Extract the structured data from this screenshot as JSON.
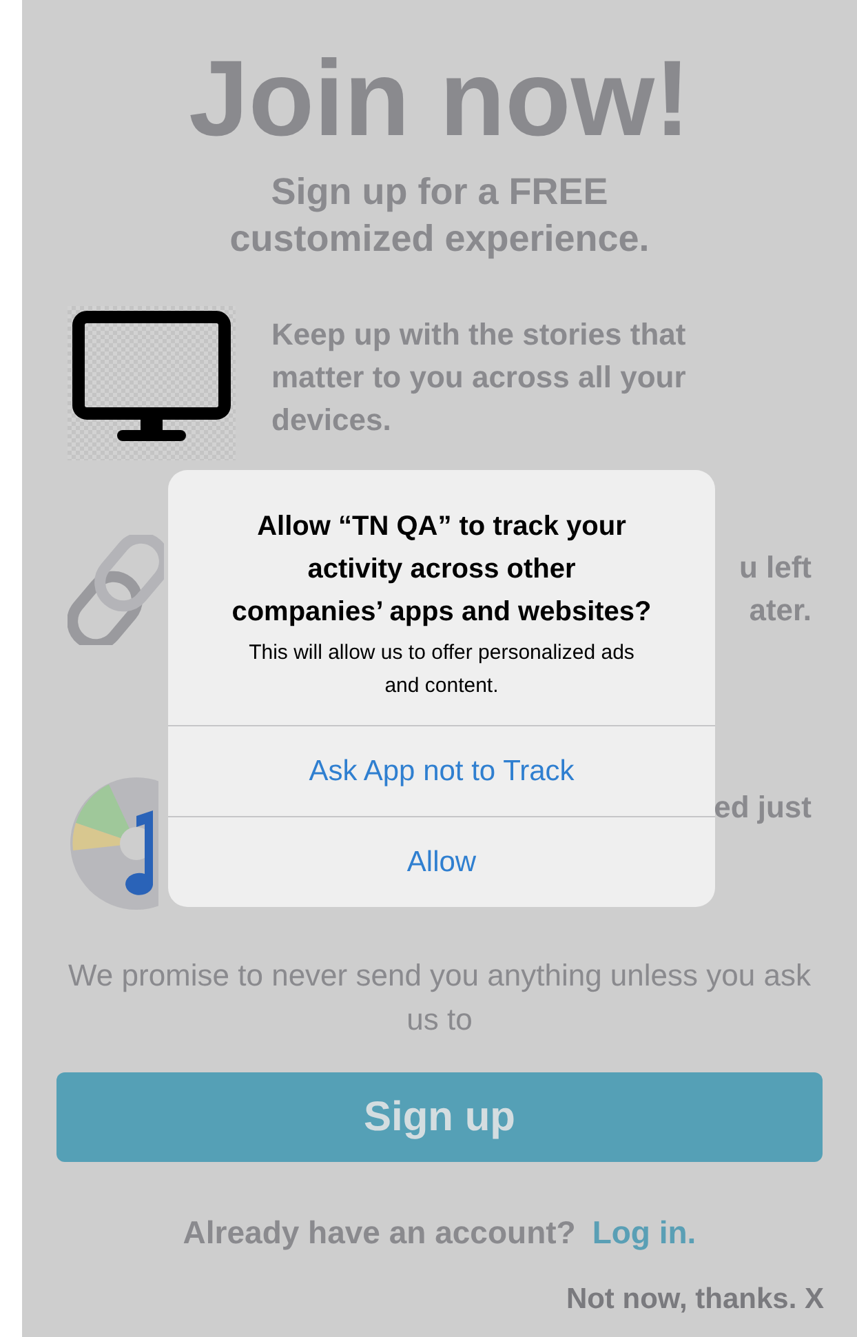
{
  "title": "Join now!",
  "subtitle": "Sign up for a FREE customized experience.",
  "features": [
    {
      "kind": "monitor",
      "text": "Keep up with the stories that matter to you across all your devices."
    },
    {
      "kind": "chain",
      "fragments": [
        "u left",
        "ater."
      ]
    },
    {
      "kind": "disc",
      "fragments": [
        "ed just"
      ]
    }
  ],
  "promise": "We promise to never send you anything unless you ask us to",
  "signup_button": "Sign up",
  "login_prompt": {
    "text": "Already have an account?",
    "link": "Log in."
  },
  "dismiss": "Not now, thanks. X",
  "alert": {
    "title": "Allow “TN QA” to track your activity across other companies’ apps and websites?",
    "message": "This will allow us to offer personalized ads and content.",
    "buttons": [
      "Ask App not to Track",
      "Allow"
    ]
  }
}
